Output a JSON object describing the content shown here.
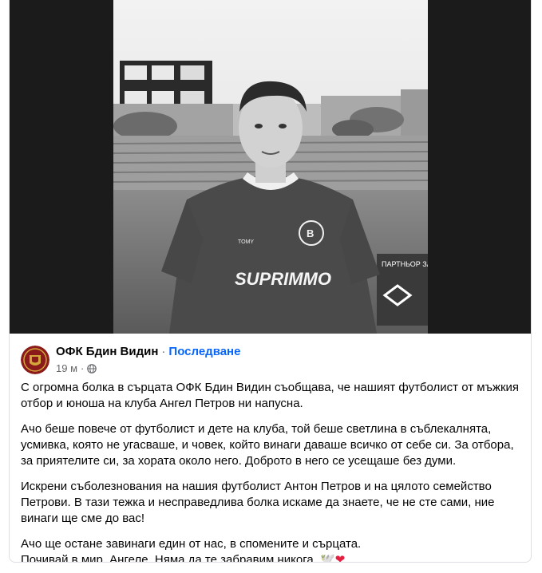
{
  "post": {
    "page_name": "ОФК Бдин Видин",
    "separator": "·",
    "follow_label": "Последване",
    "time": "19 м",
    "time_separator": "·",
    "audience_icon": "globe-icon",
    "paragraphs": [
      "С огромна болка в сърцата ОФК Бдин Видин съобщава, че нашият футболист от мъжкия отбор и юноша на клуба Ангел Петров ни напусна.",
      "Ачо беше повече от футболист и дете на клуба, той беше светлина в съблекалнята, усмивка, която не угасваше, и човек, който винаги даваше всичко от себе си. За отбора, за приятелите си, за хората около него. Доброто в него се усещаше без думи.",
      "Искрени съболезнования на нашия футболист Антон Петров и на цялото семейство Петрови. В тази тежка и несправедлива болка искаме да знаете, че не сте сами, ние винаги ще сме до вас!",
      "Ачо ще остане завинаги един от нас, в спомените и сърцата.",
      "Почивай в мир, Ангеле. Няма да те забравим никога."
    ],
    "end_emoji_dove": "🕊️",
    "end_emoji_heart": "❤"
  },
  "photo": {
    "jersey_sponsor": "SUPRIMMO",
    "jersey_brand": "TOMY",
    "jersey_badge": "B",
    "banner_text": "ПАРТНЬОР ЗА"
  },
  "colors": {
    "follow": "#0866ff",
    "text": "#050505",
    "muted": "#65676b",
    "heart": "#e41e3f",
    "avatar_bg": "#8b1a1a",
    "avatar_gold": "#d4a53a"
  }
}
